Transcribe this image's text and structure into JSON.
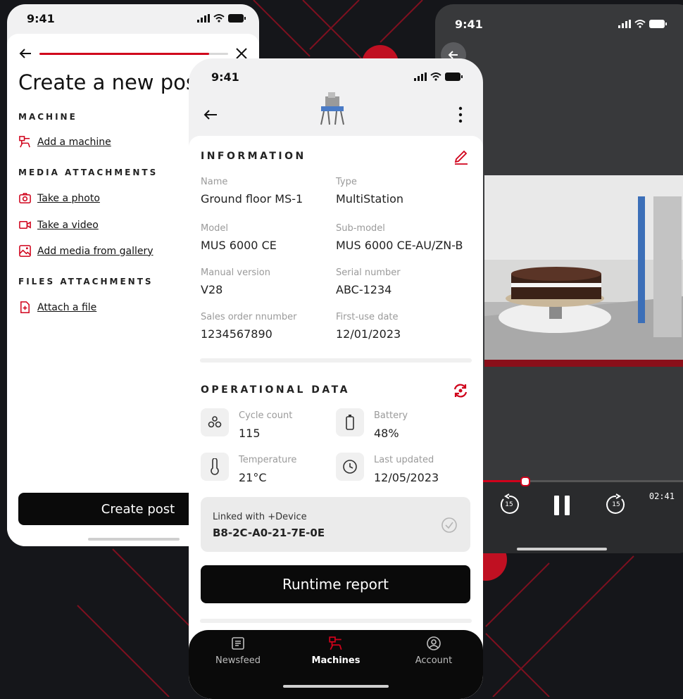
{
  "colors": {
    "accent": "#d0021b",
    "background": "#15161a",
    "dark_button": "#0a0a0a"
  },
  "status_bar": {
    "time": "9:41"
  },
  "create_post": {
    "title": "Create a new post",
    "progress_fraction": 0.9,
    "sections": {
      "machine": {
        "heading": "MACHINE",
        "items": [
          {
            "label": "Add a machine",
            "icon": "machine-icon"
          }
        ]
      },
      "media": {
        "heading": "MEDIA ATTACHMENTS",
        "items": [
          {
            "label": "Take a photo",
            "icon": "camera-icon"
          },
          {
            "label": "Take a video",
            "icon": "video-camera-icon"
          },
          {
            "label": "Add media from gallery",
            "icon": "gallery-icon"
          }
        ]
      },
      "files": {
        "heading": "FILES ATTACHMENTS",
        "items": [
          {
            "label": "Attach a file",
            "icon": "file-add-icon"
          }
        ]
      }
    },
    "create_button": "Create post"
  },
  "machine_detail": {
    "information": {
      "heading": "INFORMATION",
      "fields": [
        {
          "label": "Name",
          "value": "Ground floor MS-1"
        },
        {
          "label": "Type",
          "value": "MultiStation"
        },
        {
          "label": "Model",
          "value": "MUS 6000 CE"
        },
        {
          "label": "Sub-model",
          "value": "MUS 6000 CE-AU/ZN-B"
        },
        {
          "label": "Manual version",
          "value": "V28"
        },
        {
          "label": "Serial number",
          "value": "ABC-1234"
        },
        {
          "label": "Sales order nnumber",
          "value": "1234567890"
        },
        {
          "label": "First-use date",
          "value": "12/01/2023"
        }
      ]
    },
    "operational": {
      "heading": "OPERATIONAL DATA",
      "items": [
        {
          "label": "Cycle count",
          "value": "115",
          "icon": "drops-icon"
        },
        {
          "label": "Battery",
          "value": "48%",
          "icon": "battery-icon"
        },
        {
          "label": "Temperature",
          "value": "21°C",
          "icon": "thermometer-icon"
        },
        {
          "label": "Last updated",
          "value": "12/05/2023",
          "icon": "clock-icon"
        }
      ]
    },
    "linked": {
      "label": "Linked with +Device",
      "device_id": "B8-2C-A0-21-7E-0E"
    },
    "runtime_button": "Runtime report"
  },
  "tabbar": {
    "tabs": [
      {
        "label": "Newsfeed",
        "icon": "newsfeed-icon",
        "active": false
      },
      {
        "label": "Machines",
        "icon": "machine-icon",
        "active": true
      },
      {
        "label": "Account",
        "icon": "account-icon",
        "active": false
      }
    ]
  },
  "video_player": {
    "elapsed_fraction": 0.22,
    "time_remaining": "02:41",
    "skip_seconds": "15"
  }
}
